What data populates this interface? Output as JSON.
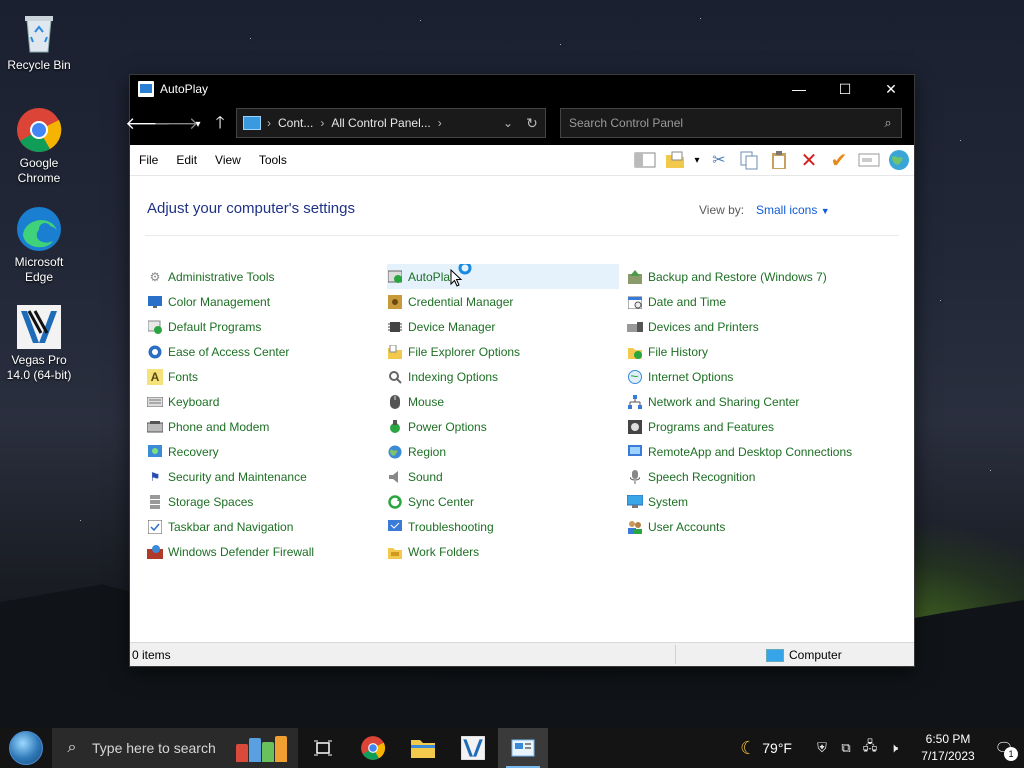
{
  "desktop": {
    "icons": [
      {
        "label": "Recycle Bin"
      },
      {
        "label": "Google Chrome"
      },
      {
        "label": "Microsoft Edge"
      },
      {
        "label": "Vegas Pro 14.0 (64-bit)"
      }
    ]
  },
  "window": {
    "title": "AutoPlay",
    "controls": {
      "minimize": "—",
      "maximize": "☐",
      "close": "✕"
    },
    "address": {
      "crumbs": [
        "Cont...",
        "All Control Panel..."
      ]
    },
    "search": {
      "placeholder": "Search Control Panel"
    },
    "menu": [
      "File",
      "Edit",
      "View",
      "Tools"
    ],
    "heading": "Adjust your computer's settings",
    "view_by": {
      "label": "View by:",
      "value": "Small icons"
    },
    "columns": [
      [
        "Administrative Tools",
        "Color Management",
        "Default Programs",
        "Ease of Access Center",
        "Fonts",
        "Keyboard",
        "Phone and Modem",
        "Recovery",
        "Security and Maintenance",
        "Storage Spaces",
        "Taskbar and Navigation",
        "Windows Defender Firewall"
      ],
      [
        "AutoPlay",
        "Credential Manager",
        "Device Manager",
        "File Explorer Options",
        "Indexing Options",
        "Mouse",
        "Power Options",
        "Region",
        "Sound",
        "Sync Center",
        "Troubleshooting",
        "Work Folders"
      ],
      [
        "Backup and Restore (Windows 7)",
        "Date and Time",
        "Devices and Printers",
        "File History",
        "Internet Options",
        "Network and Sharing Center",
        "Programs and Features",
        "RemoteApp and Desktop Connections",
        "Speech Recognition",
        "System",
        "User Accounts"
      ]
    ],
    "status": {
      "items": "0 items",
      "location": "Computer"
    }
  },
  "taskbar": {
    "search_placeholder": "Type here to search",
    "weather": "79°F",
    "time": "6:50 PM",
    "date": "7/17/2023",
    "notification_count": "1"
  }
}
